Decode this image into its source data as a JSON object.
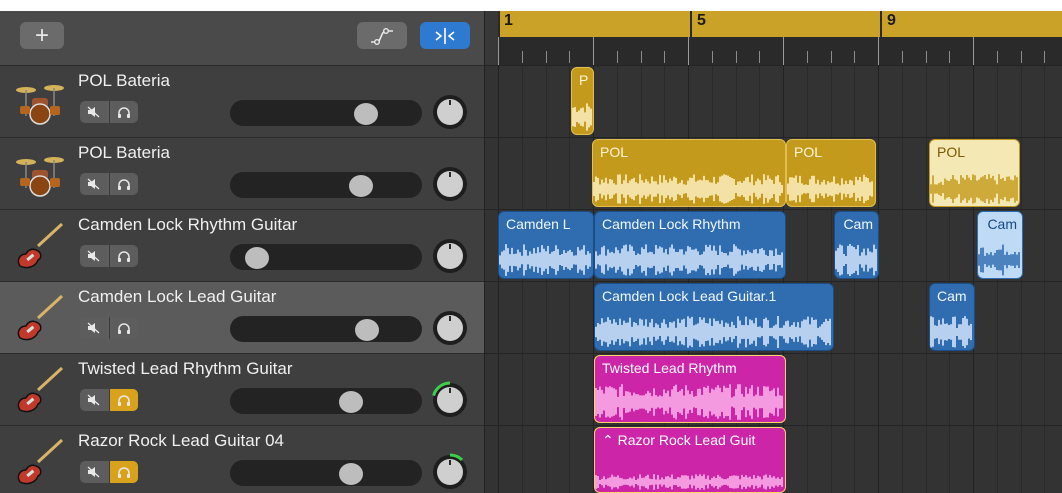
{
  "toolbar": {
    "add_label": "+",
    "add_icon": "plus-icon",
    "automation_icon": "automation-curve-icon",
    "snap_icon": "smart-controls-icon"
  },
  "ruler": {
    "bars": [
      "1",
      "5",
      "9"
    ]
  },
  "tracks": [
    {
      "name": "POL Bateria",
      "icon": "drum-kit-icon",
      "mute": false,
      "solo": false,
      "volume": 0.75,
      "pan": 0.5
    },
    {
      "name": "POL Bateria",
      "icon": "drum-kit-icon",
      "mute": false,
      "solo": false,
      "volume": 0.72,
      "pan": 0.5
    },
    {
      "name": "Camden Lock Rhythm Guitar",
      "icon": "electric-guitar-icon",
      "mute": false,
      "solo": false,
      "volume": 0.08,
      "pan": 0.5
    },
    {
      "name": "Camden Lock Lead Guitar",
      "icon": "electric-guitar-icon",
      "mute": false,
      "solo": false,
      "volume": 0.76,
      "pan": 0.5
    },
    {
      "name": "Twisted Lead Rhythm Guitar",
      "icon": "electric-guitar-icon",
      "mute": false,
      "solo": true,
      "volume": 0.66,
      "pan": 0.25
    },
    {
      "name": "Razor Rock Lead Guitar 04",
      "icon": "electric-guitar-icon",
      "mute": false,
      "solo": true,
      "volume": 0.66,
      "pan": 0.65
    }
  ],
  "regions": {
    "track1": [
      {
        "label": "P"
      }
    ],
    "track2": [
      {
        "label": "POL"
      },
      {
        "label": "POL"
      },
      {
        "label": "POL"
      }
    ],
    "track3": [
      {
        "label": "Camden L"
      },
      {
        "label": "Camden Lock Rhythm"
      },
      {
        "label": "Cam"
      },
      {
        "label": "Cam"
      }
    ],
    "track4": [
      {
        "label": "Camden Lock Lead Guitar.1"
      },
      {
        "label": "Cam"
      }
    ],
    "track5": [
      {
        "label": "Twisted Lead Rhythm"
      }
    ],
    "track6": [
      {
        "label": "⌃ Razor Rock Lead Guit"
      }
    ]
  },
  "colors": {
    "ruler_gold": "#c9a227",
    "audio_gold": "#c49a1c",
    "audio_blue": "#2f6db0",
    "audio_pink": "#cc25a8",
    "solo_on": "#d9a21c",
    "accent_blue": "#2e7ad1",
    "pan_green": "#3ecf4a"
  }
}
